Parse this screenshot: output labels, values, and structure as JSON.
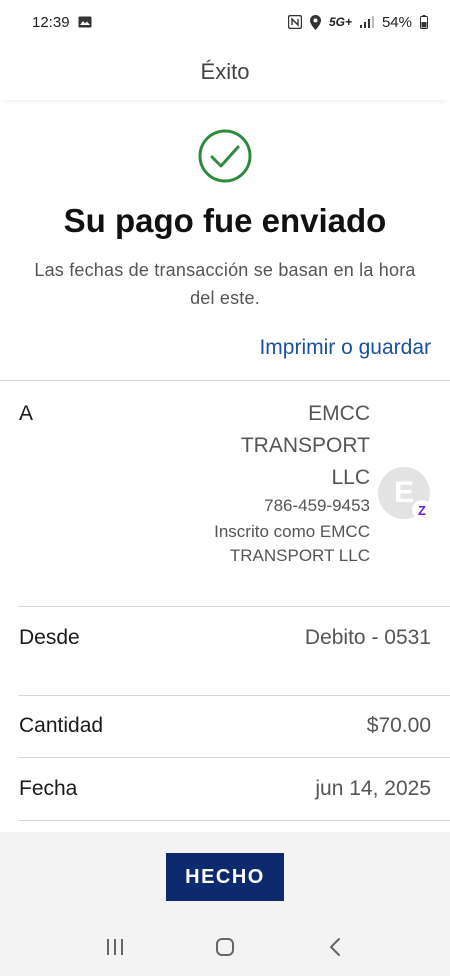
{
  "status_bar": {
    "time": "12:39",
    "network": "5G+",
    "battery": "54%",
    "icons": [
      "image-icon",
      "nfc-icon",
      "location-icon",
      "signal-icon",
      "battery-icon"
    ]
  },
  "header": {
    "title": "Éxito"
  },
  "confirmation": {
    "title": "Su pago fue enviado",
    "subtitle": "Las fechas de transacción se basan en la hora del este.",
    "print_link": "Imprimir o guardar",
    "icon": "check-circle-icon",
    "icon_color": "#2e8b3e"
  },
  "details": {
    "to": {
      "label": "A",
      "name": "EMCC TRANSPORT LLC",
      "phone": "786-459-9453",
      "enrolled": "Inscrito como EMCC TRANSPORT LLC",
      "avatar_letter": "E",
      "badge": "Z"
    },
    "from": {
      "label": "Desde",
      "value": "Debito - 0531"
    },
    "amount": {
      "label": "Cantidad",
      "value": "$70.00"
    },
    "date": {
      "label": "Fecha",
      "value": "jun 14, 2025"
    }
  },
  "actions": {
    "done_label": "HECHO"
  },
  "nav": {
    "items": [
      "recent-apps-icon",
      "home-icon",
      "back-icon"
    ]
  },
  "colors": {
    "accent": "#1c4f9c",
    "button": "#0d2a6e",
    "success": "#2e8b3e",
    "zelle": "#6d1ed4"
  }
}
